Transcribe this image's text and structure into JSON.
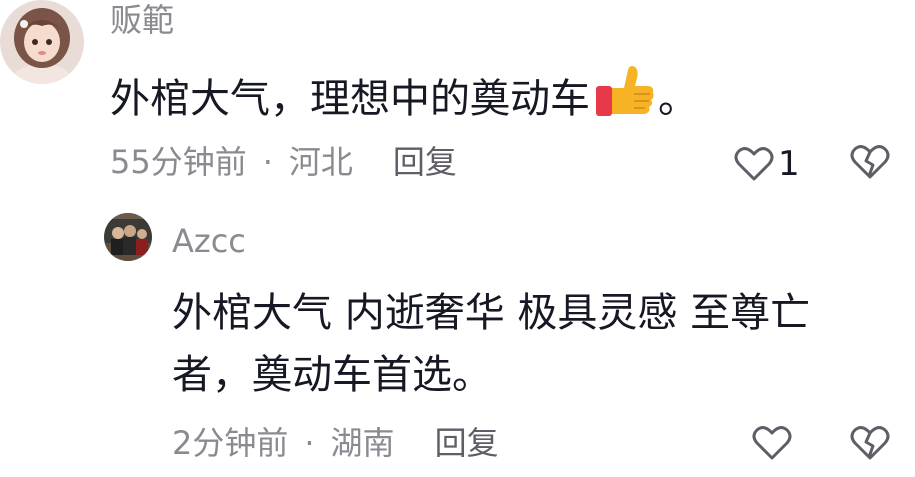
{
  "comments": [
    {
      "username": "贩範",
      "text": "外棺大气，理想中的奠动车",
      "text_suffix": "。",
      "emoji": "thumbs-up-icon",
      "time": "55分钟前",
      "separator": "·",
      "location": "河北",
      "reply_label": "回复",
      "like_count": "1",
      "avatar": "girl-portrait-avatar"
    },
    {
      "username": "Azcc",
      "text": "外棺大气 内逝奢华 极具灵感 至尊亡者，奠动车首选。",
      "time": "2分钟前",
      "separator": "·",
      "location": "湖南",
      "reply_label": "回复",
      "like_count": "",
      "avatar": "group-photo-avatar"
    }
  ],
  "colors": {
    "text_primary": "#161823",
    "text_secondary": "#8a8b91",
    "icon": "#5d5e66",
    "thumb": "#f5b325",
    "sleeve": "#e8394a"
  }
}
